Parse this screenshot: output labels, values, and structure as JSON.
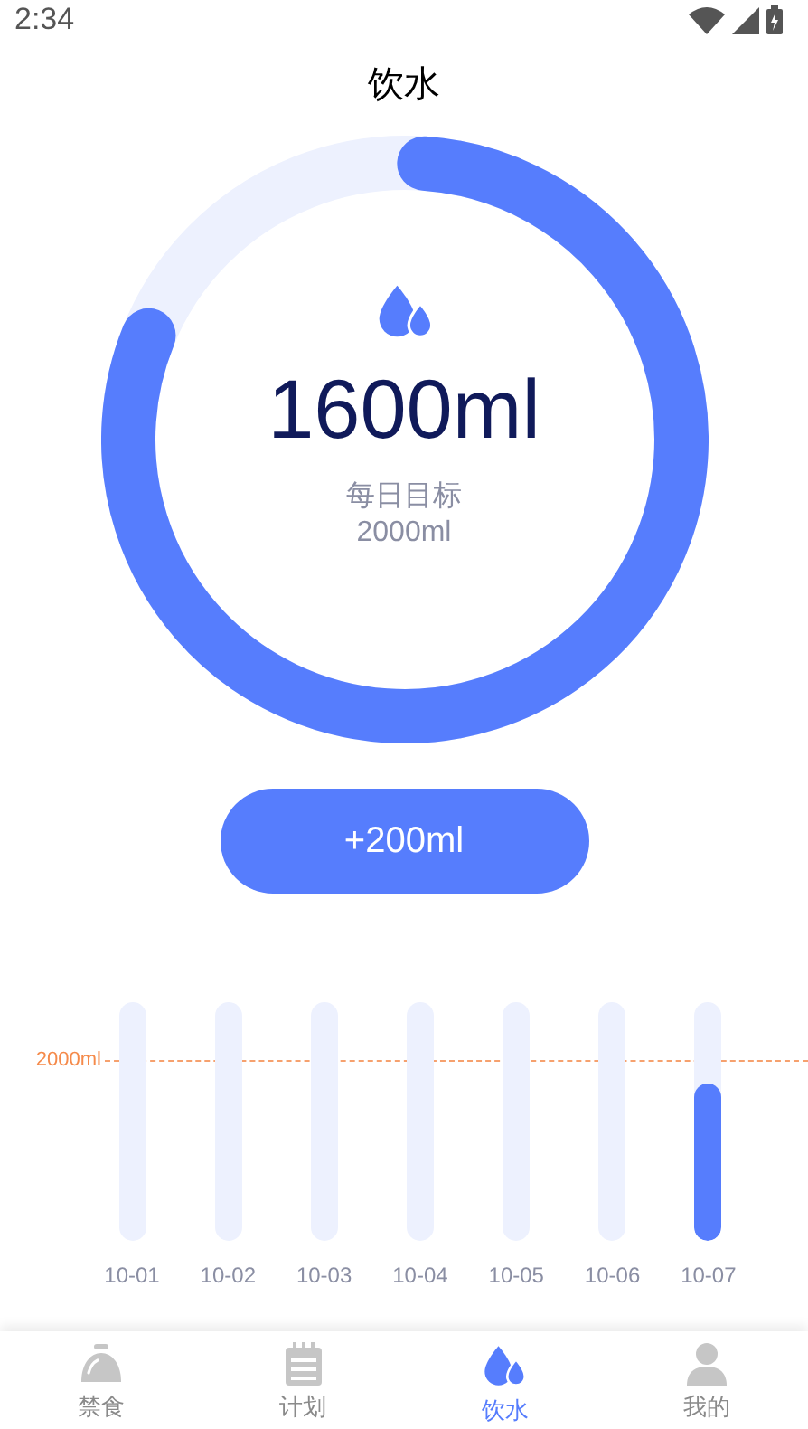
{
  "status_bar": {
    "time": "2:34"
  },
  "title": "饮水",
  "progress": {
    "level": 0.8,
    "amount": "1600ml",
    "goal_label": "每日目标",
    "goal": "2000ml"
  },
  "add_button": "+200ml",
  "history": {
    "goal_line": "2000ml",
    "days": [
      {
        "label": "10-01",
        "level": 0
      },
      {
        "label": "10-02",
        "level": 0
      },
      {
        "label": "10-03",
        "level": 0
      },
      {
        "label": "10-04",
        "level": 0
      },
      {
        "label": "10-05",
        "level": 0
      },
      {
        "label": "10-06",
        "level": 0
      },
      {
        "label": "10-07",
        "level": 0.66
      }
    ]
  },
  "tabs": [
    {
      "kind": "bell",
      "label": "禁食",
      "selected": false
    },
    {
      "kind": "notepad",
      "label": "计划",
      "selected": false
    },
    {
      "kind": "drops",
      "label": "饮水",
      "selected": true
    },
    {
      "kind": "person",
      "label": "我的",
      "selected": false
    }
  ]
}
